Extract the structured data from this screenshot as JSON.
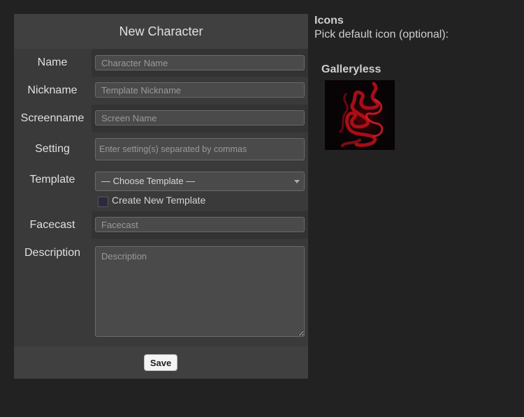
{
  "panel": {
    "title": "New Character"
  },
  "fields": {
    "name": {
      "label": "Name",
      "placeholder": "Character Name"
    },
    "nickname": {
      "label": "Nickname",
      "placeholder": "Template Nickname"
    },
    "screenname": {
      "label": "Screenname",
      "placeholder": "Screen Name"
    },
    "setting": {
      "label": "Setting",
      "placeholder": "Enter setting(s) separated by commas"
    },
    "template": {
      "label": "Template",
      "selected": "— Choose Template —",
      "create_label": "Create New Template"
    },
    "facecast": {
      "label": "Facecast",
      "placeholder": "Facecast"
    },
    "description": {
      "label": "Description",
      "placeholder": "Description"
    }
  },
  "footer": {
    "save_label": "Save"
  },
  "icons": {
    "title": "Icons",
    "subtitle": "Pick default icon (optional):",
    "gallery_name": "Galleryless"
  },
  "colors": {
    "background": "#222222",
    "panel": "#3a3a3a",
    "accent_icon": "#c0101a"
  }
}
